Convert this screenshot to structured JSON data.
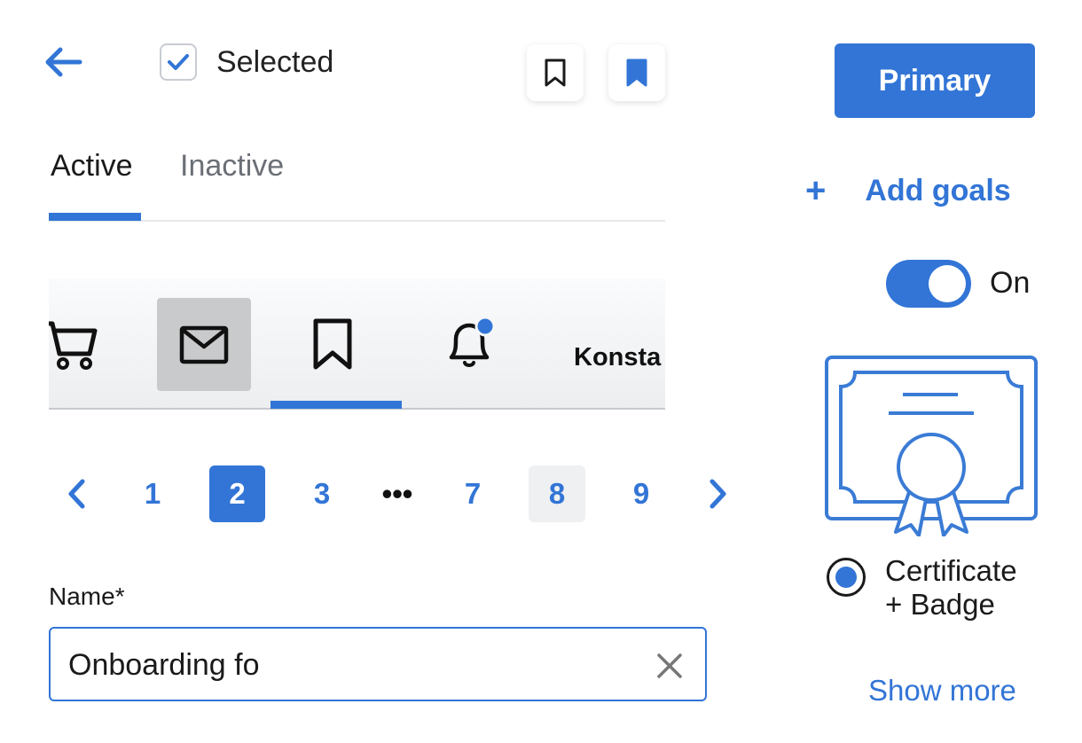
{
  "header": {
    "checkbox_label": "Selected",
    "checkbox_checked": true,
    "primary_label": "Primary"
  },
  "tabs": [
    {
      "label": "Active",
      "active": true
    },
    {
      "label": "Inactive",
      "active": false
    }
  ],
  "actions": {
    "add_goals_plus": "+",
    "add_goals_label": "Add goals"
  },
  "toggle": {
    "state": "on",
    "label": "On"
  },
  "icon_nav": {
    "items": [
      "cart-icon",
      "mail-icon",
      "bookmark-icon",
      "bell-icon"
    ],
    "selected": "mail-icon",
    "active": "bookmark-icon",
    "bell_has_notification": true,
    "user_name": "Konsta"
  },
  "pagination": {
    "pages": [
      "1",
      "2",
      "3",
      "•••",
      "7",
      "8",
      "9"
    ],
    "current": "2"
  },
  "award": {
    "option_label_line1": "Certificate",
    "option_label_line2": "+ Badge",
    "selected": true,
    "show_more": "Show more"
  },
  "form": {
    "name_label": "Name*",
    "name_value": "Onboarding fo"
  },
  "colors": {
    "accent": "#3275d6",
    "muted": "#6b6f76",
    "selected_bg": "#c9cacb"
  }
}
